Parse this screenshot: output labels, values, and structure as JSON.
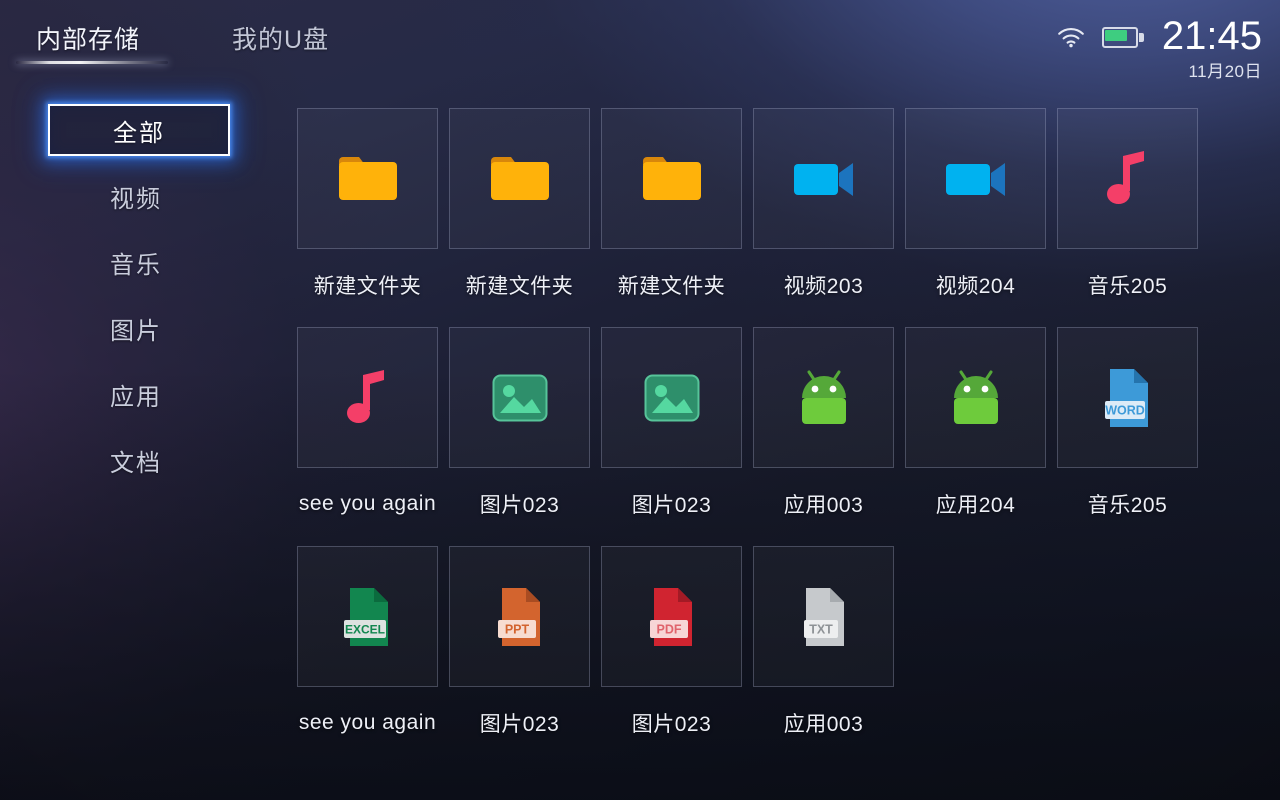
{
  "header": {
    "tabs": [
      {
        "label": "内部存储",
        "active": true
      },
      {
        "label": "我的U盘",
        "active": false
      }
    ],
    "status": {
      "wifi_icon": "wifi-icon",
      "battery_icon": "battery-icon",
      "battery_level_percent": 70,
      "time": "21:45",
      "date": "11月20日"
    }
  },
  "sidebar": {
    "items": [
      {
        "label": "全部",
        "selected": true
      },
      {
        "label": "视频",
        "selected": false
      },
      {
        "label": "音乐",
        "selected": false
      },
      {
        "label": "图片",
        "selected": false
      },
      {
        "label": "应用",
        "selected": false
      },
      {
        "label": "文档",
        "selected": false
      }
    ]
  },
  "grid": {
    "items": [
      {
        "label": "新建文件夹",
        "icon": "folder-icon"
      },
      {
        "label": "新建文件夹",
        "icon": "folder-icon"
      },
      {
        "label": "新建文件夹",
        "icon": "folder-icon"
      },
      {
        "label": "视频203",
        "icon": "video-icon"
      },
      {
        "label": "视频204",
        "icon": "video-icon"
      },
      {
        "label": "音乐205",
        "icon": "music-note-icon"
      },
      {
        "label": "see you again",
        "icon": "music-note-icon"
      },
      {
        "label": "图片023",
        "icon": "image-icon"
      },
      {
        "label": "图片023",
        "icon": "image-icon"
      },
      {
        "label": "应用003",
        "icon": "android-icon"
      },
      {
        "label": "应用204",
        "icon": "android-icon"
      },
      {
        "label": "音乐205",
        "icon": "word-file-icon",
        "badge": "WORD"
      },
      {
        "label": "see you again",
        "icon": "excel-file-icon",
        "badge": "EXCEL"
      },
      {
        "label": "图片023",
        "icon": "ppt-file-icon",
        "badge": "PPT"
      },
      {
        "label": "图片023",
        "icon": "pdf-file-icon",
        "badge": "PDF"
      },
      {
        "label": "应用003",
        "icon": "txt-file-icon",
        "badge": "TXT"
      }
    ]
  },
  "colors": {
    "folder": "#FFB20A",
    "folder_tab": "#D8870B",
    "video_body": "#00B2F0",
    "video_lens": "#1C74BE",
    "music_note": "#F43F68",
    "image_frame": "#2E8F6B",
    "image_art": "#55D8A0",
    "android": "#6ECB3C",
    "android_head": "#55A839",
    "word": "#3D9AD8",
    "excel": "#12864F",
    "ppt": "#D3642E",
    "pdf": "#D02430",
    "txt": "#C6C9CC",
    "selected_glow": "#3076F0",
    "battery_fill": "#3ECD80"
  }
}
